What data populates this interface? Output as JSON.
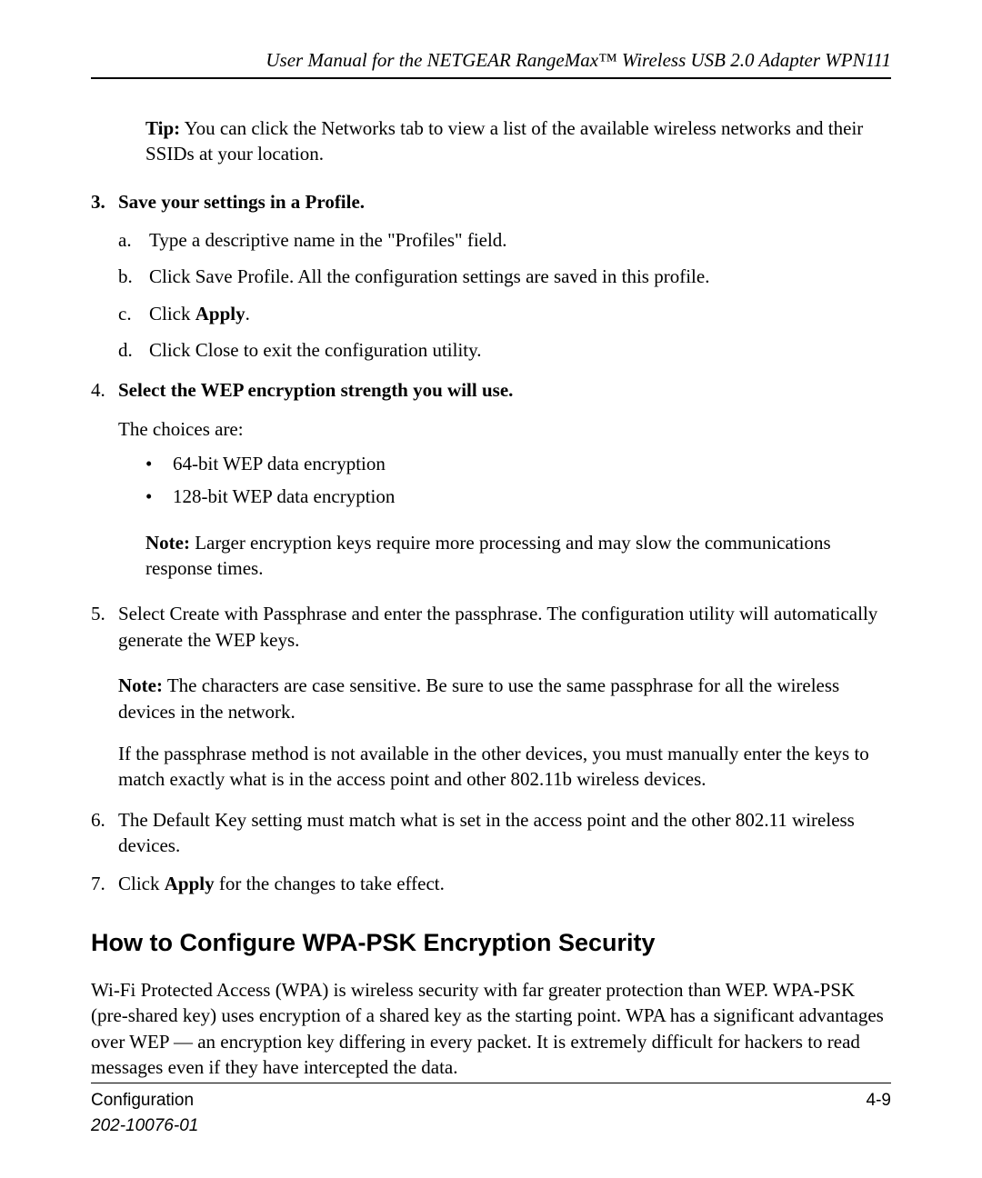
{
  "header": {
    "title": "User Manual for the NETGEAR RangeMax™ Wireless USB 2.0 Adapter WPN111"
  },
  "tip": {
    "label": "Tip:",
    "text": " You can click the Networks tab to view a list of the available wireless networks and their SSIDs at your location."
  },
  "step3": {
    "num": "3.",
    "title": "Save your settings in a Profile.",
    "a": {
      "marker": "a.",
      "text": "Type a descriptive name in the \"Profiles\" field."
    },
    "b": {
      "marker": "b.",
      "text": "Click Save Profile. All the configuration settings are saved in this profile."
    },
    "c": {
      "marker": "c.",
      "prefix": "Click ",
      "bold": "Apply",
      "suffix": "."
    },
    "d": {
      "marker": "d.",
      "text": "Click Close to exit the configuration utility."
    }
  },
  "step4": {
    "num": "4.",
    "title": "Select the WEP encryption strength you will use.",
    "intro": "The choices are:",
    "bullets": {
      "b1": "64-bit WEP data encryption",
      "b2": "128-bit WEP data encryption"
    },
    "note": {
      "label": "Note:",
      "text": " Larger encryption keys require more processing and may slow the communications response times."
    }
  },
  "step5": {
    "num": "5.",
    "text": "Select Create with Passphrase and enter the passphrase. The configuration utility will automatically generate the WEP keys.",
    "note": {
      "label": "Note:",
      "text": " The characters are case sensitive. Be sure to use the same passphrase for all the wireless devices in the network."
    },
    "extra": "If the passphrase method is not available in the other devices, you must manually enter the keys to match exactly what is in the access point and other 802.11b wireless devices."
  },
  "step6": {
    "num": "6.",
    "text": "The Default Key setting must match what is set in the access point and the other 802.11 wireless devices."
  },
  "step7": {
    "num": "7.",
    "prefix": "Click ",
    "bold": "Apply",
    "suffix": " for the changes to take effect."
  },
  "section": {
    "heading": "How to Configure WPA-PSK Encryption Security",
    "para": "Wi-Fi Protected Access (WPA) is wireless security with far greater protection than WEP. WPA-PSK (pre-shared key) uses encryption of a shared key as the starting point. WPA has a significant advantages over WEP — an encryption key differing in every packet. It is extremely difficult for hackers to read messages even if they have intercepted the data."
  },
  "footer": {
    "left": "Configuration",
    "right": "4-9",
    "doc": "202-10076-01"
  }
}
